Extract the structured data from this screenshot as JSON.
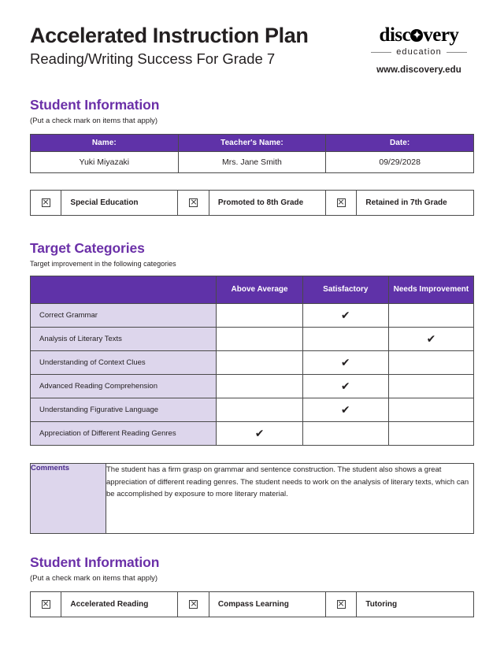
{
  "header": {
    "title": "Accelerated Instruction Plan",
    "subtitle": "Reading/Writing Success For Grade 7",
    "logo": {
      "word_before": "disc",
      "word_after": "very",
      "subtext": "education",
      "url": "www.discovery.edu"
    }
  },
  "student_information": {
    "heading": "Student Information",
    "note": "(Put a check mark on items that apply)",
    "fields": [
      {
        "label": "Name:",
        "value": "Yuki Miyazaki"
      },
      {
        "label": "Teacher's Name:",
        "value": "Mrs. Jane Smith"
      },
      {
        "label": "Date:",
        "value": "09/29/2028"
      }
    ],
    "checkboxes": [
      {
        "label": "Special Education",
        "checked": false
      },
      {
        "label": "Promoted to 8th Grade",
        "checked": false
      },
      {
        "label": "Retained in 7th Grade",
        "checked": false
      }
    ]
  },
  "target_categories": {
    "heading": "Target Categories",
    "note": "Target improvement in the following categories",
    "columns": [
      "",
      "Above Average",
      "Satisfactory",
      "Needs Improvement"
    ],
    "rows": [
      {
        "label": "Correct Grammar",
        "above_average": "",
        "satisfactory": "✔",
        "needs_improvement": ""
      },
      {
        "label": "Analysis of Literary Texts",
        "above_average": "",
        "satisfactory": "",
        "needs_improvement": "✔"
      },
      {
        "label": "Understanding of Context Clues",
        "above_average": "",
        "satisfactory": "✔",
        "needs_improvement": ""
      },
      {
        "label": "Advanced Reading Comprehension",
        "above_average": "",
        "satisfactory": "✔",
        "needs_improvement": ""
      },
      {
        "label": "Understanding Figurative Language",
        "above_average": "",
        "satisfactory": "✔",
        "needs_improvement": ""
      },
      {
        "label": "Appreciation of Different Reading Genres",
        "above_average": "✔",
        "satisfactory": "",
        "needs_improvement": ""
      }
    ]
  },
  "comments": {
    "label": "Comments",
    "text": "The student has a firm grasp on grammar and sentence construction. The student also shows a great appreciation of different reading genres. The student needs to work on the analysis of literary texts, which can be accomplished by exposure to more literary material."
  },
  "student_information_bottom": {
    "heading": "Student Information",
    "note": "(Put a check mark on items that apply)",
    "checkboxes": [
      {
        "label": "Accelerated Reading",
        "checked": false
      },
      {
        "label": "Compass Learning",
        "checked": false
      },
      {
        "label": "Tutoring",
        "checked": false
      }
    ]
  },
  "colors": {
    "purple": "#5f32a8",
    "heading_purple": "#6b30a8",
    "lavender": "#ddd6ec",
    "comments_label": "#4a2b8c"
  }
}
